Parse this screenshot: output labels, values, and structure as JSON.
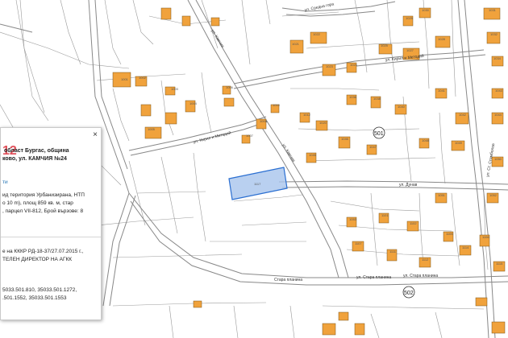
{
  "map": {
    "streets": [
      {
        "key": "st1",
        "text": "ул. Средна гора"
      },
      {
        "key": "st2",
        "text": "ул. Кирил и Методий"
      },
      {
        "key": "st3",
        "text": "ул. Кирил и Методий"
      },
      {
        "key": "st4",
        "text": "ул. Камчия"
      },
      {
        "key": "st5",
        "text": "ул. Камчия"
      },
      {
        "key": "st6",
        "text": "ул. Стара планина"
      },
      {
        "key": "st7",
        "text": "ул. Стара планина"
      },
      {
        "key": "st8",
        "text": "Стара планина"
      },
      {
        "key": "st9",
        "text": "ул. Дунав"
      },
      {
        "key": "st10",
        "text": "ул. Ст. Стамболов"
      }
    ],
    "badges": [
      "501",
      "502"
    ],
    "parcel_numbers": [
      "1001",
      "1002",
      "1003",
      "1004",
      "1005",
      "1006",
      "1007",
      "1009",
      "1010",
      "1012",
      "1020",
      "1021",
      "1022",
      "1023",
      "1024",
      "1025",
      "1027",
      "1028",
      "1029",
      "1030",
      "1031",
      "1032",
      "1034",
      "1036",
      "1038",
      "1040",
      "1041",
      "1042",
      "1043",
      "1044",
      "1045",
      "1046",
      "1047",
      "1048",
      "1049",
      "1050",
      "1051",
      "1052",
      "1053",
      "1101",
      "1102",
      "1105",
      "1106",
      "1107",
      "1111",
      "1112",
      "1114",
      "1115",
      "1117"
    ]
  },
  "info": {
    "close_label": "×",
    "flag_text": "12",
    "heading_line1": "област Бургас, община",
    "heading_line2": "ково, ул. КАМЧИЯ №24",
    "link_text": "ти",
    "desc_line1": "ид територия Урбанизирана, НТП",
    "desc_line2": "о 10 m), площ 859 кв. м, стар",
    "desc_line3": ", парцел VII-812, Брой вързове: 8",
    "desc_line4": "",
    "order_line1": "е на КККР РД-18-37/27.07.2015 г.,",
    "order_line2": "ТЕЛЕН ДИРЕКТОР НА АГКК",
    "ids_line1": "5033.501.810,        35033.501.1272,",
    "ids_line2": ".501.1552, 35033.501.1553"
  }
}
